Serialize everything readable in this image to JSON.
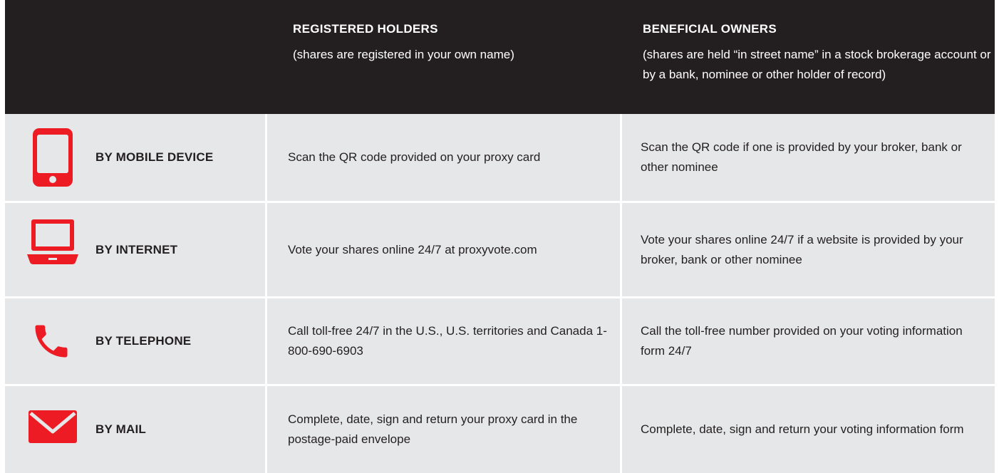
{
  "header": {
    "registered_title": "REGISTERED HOLDERS",
    "registered_sub": "(shares are registered in your own name)",
    "beneficial_title": "BENEFICIAL OWNERS",
    "beneficial_sub": "(shares are held “in street name” in a stock brokerage account or by a bank, nominee or other holder of record)"
  },
  "rows": [
    {
      "icon": "mobile-phone-icon",
      "label": "BY MOBILE DEVICE",
      "registered": "Scan the QR code provided on your proxy card",
      "beneficial": "Scan the QR code if one is provided by your broker, bank or other nominee"
    },
    {
      "icon": "laptop-icon",
      "label": "BY INTERNET",
      "registered": "Vote your shares online 24/7 at proxyvote.com",
      "beneficial": "Vote your shares online 24/7 if a website is provided by your broker, bank or other nominee"
    },
    {
      "icon": "telephone-icon",
      "label": "BY TELEPHONE",
      "registered": "Call toll-free 24/7 in the U.S., U.S. territories and Canada 1-800-690-6903",
      "beneficial": "Call the toll-free number provided on your voting information form 24/7"
    },
    {
      "icon": "envelope-icon",
      "label": "BY MAIL",
      "registered": "Complete, date, sign and return your proxy card in the postage-paid envelope",
      "beneficial": "Complete, date, sign and return your voting information form"
    }
  ],
  "colors": {
    "accent": "#ed1c24",
    "header_bg": "#231f20",
    "row_bg": "#e6e7e8"
  }
}
